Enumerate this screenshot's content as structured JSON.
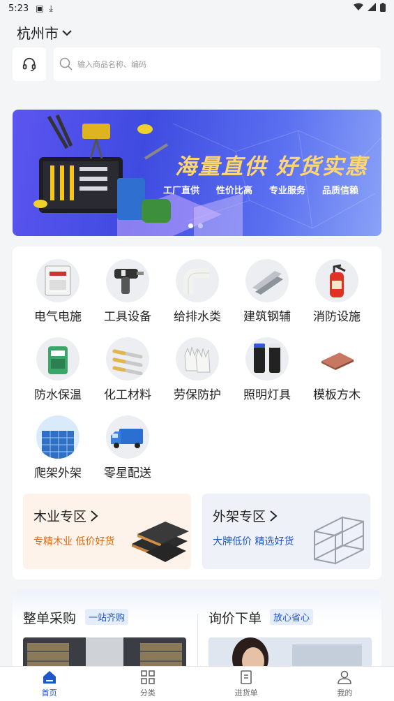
{
  "status_bar": {
    "time": "5:23"
  },
  "header": {
    "city": "杭州市"
  },
  "search": {
    "placeholder": "输入商品名称、编码"
  },
  "banner": {
    "headline": "海量直供  好货实惠",
    "features": [
      "工厂直供",
      "性价比高",
      "专业服务",
      "品质信赖"
    ],
    "active_slide": 1,
    "slide_count": 2
  },
  "categories": [
    {
      "label": "电气电施",
      "icon": "electrical-box-icon"
    },
    {
      "label": "工具设备",
      "icon": "drill-icon"
    },
    {
      "label": "给排水类",
      "icon": "pipe-elbow-icon"
    },
    {
      "label": "建筑钢辅",
      "icon": "steel-angle-icon"
    },
    {
      "label": "消防设施",
      "icon": "fire-extinguisher-icon"
    },
    {
      "label": "防水保温",
      "icon": "waterproof-bucket-icon"
    },
    {
      "label": "化工材料",
      "icon": "anchor-bolt-icon"
    },
    {
      "label": "劳保防护",
      "icon": "gloves-icon"
    },
    {
      "label": "照明灯具",
      "icon": "lamp-icon"
    },
    {
      "label": "模板方木",
      "icon": "plywood-icon"
    },
    {
      "label": "爬架外架",
      "icon": "scaffold-icon"
    },
    {
      "label": "零星配送",
      "icon": "delivery-truck-icon"
    }
  ],
  "zones": [
    {
      "title": "木业专区",
      "subtitle": "专精木业 低价好货",
      "subtitle_color": "#e06a12",
      "bg": "#fdf3ea"
    },
    {
      "title": "外架专区",
      "subtitle": "大牌低价 精选好货",
      "subtitle_color": "#1f56c9",
      "bg": "#eef2f8"
    }
  ],
  "procurement": [
    {
      "title": "整单采购",
      "tag": "一站齐购"
    },
    {
      "title": "询价下单",
      "tag": "放心省心"
    }
  ],
  "tabbar": [
    {
      "label": "首页",
      "active": true
    },
    {
      "label": "分类",
      "active": false
    },
    {
      "label": "进货单",
      "active": false
    },
    {
      "label": "我的",
      "active": false
    }
  ]
}
